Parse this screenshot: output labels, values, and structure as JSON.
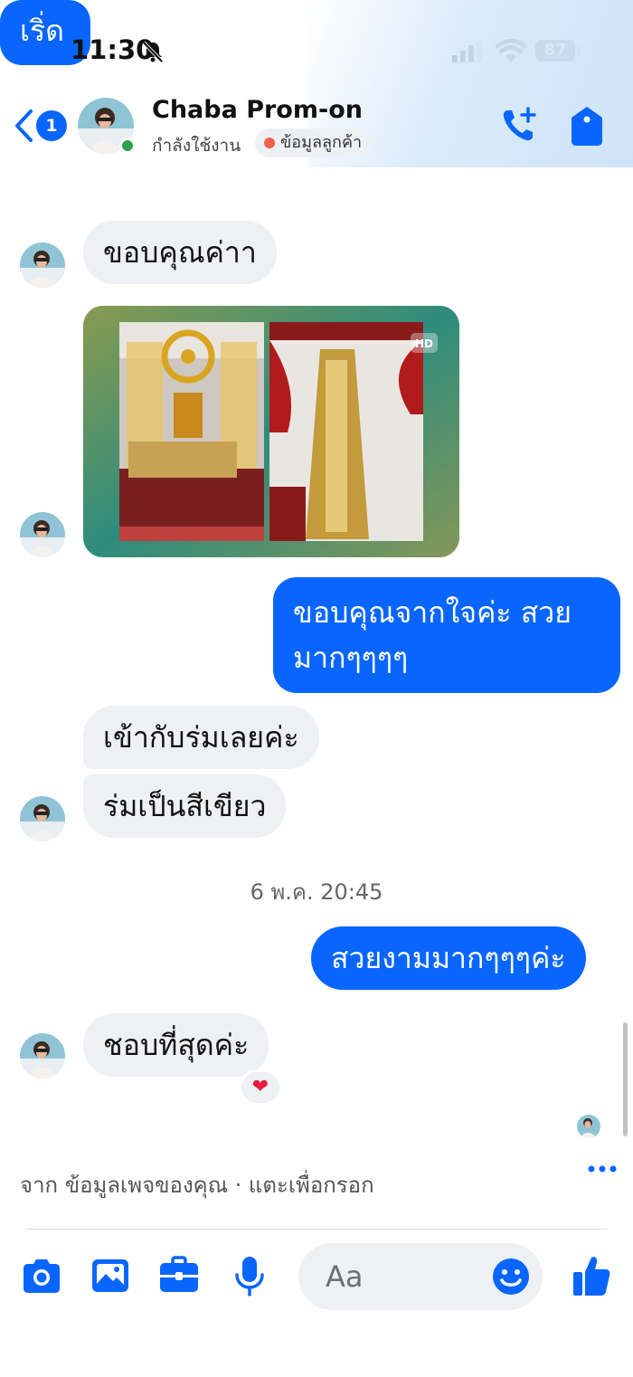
{
  "status_bar": {
    "time": "11:30",
    "battery": "87"
  },
  "header": {
    "back_count": "1",
    "contact_name": "Chaba Prom-on",
    "active_status": "กำลังใช้งาน",
    "customer_label": "ข้อมูลลูกค้า"
  },
  "messages": {
    "top_partial_out": "เริ่ด",
    "thanks_in": "ขอบคุณค่าา",
    "image_badge": "HD",
    "thanks_out": [
      "ขอบคุณจากใจค่ะ สวย",
      "มากๆๆๆๆ"
    ],
    "matches_in": "เข้ากับร่มเลยค่ะ",
    "umbrella_in": "ร่มเป็นสีเขียว",
    "timestamp": "6 พ.ค. 20:45",
    "beautiful_out": "สวยงามมากๆๆๆค่ะ",
    "love_in": "ชอบที่สุดค่ะ",
    "reaction": "❤"
  },
  "composer": {
    "autofill_hint": "จาก ข้อมูลเพจของคุณ · แตะเพื่อกรอก",
    "placeholder": "Aa"
  },
  "colors": {
    "accent": "#0866ff",
    "bubble_in": "#eef0f3",
    "online": "#31a24c",
    "customer_dot": "#f0614f"
  }
}
